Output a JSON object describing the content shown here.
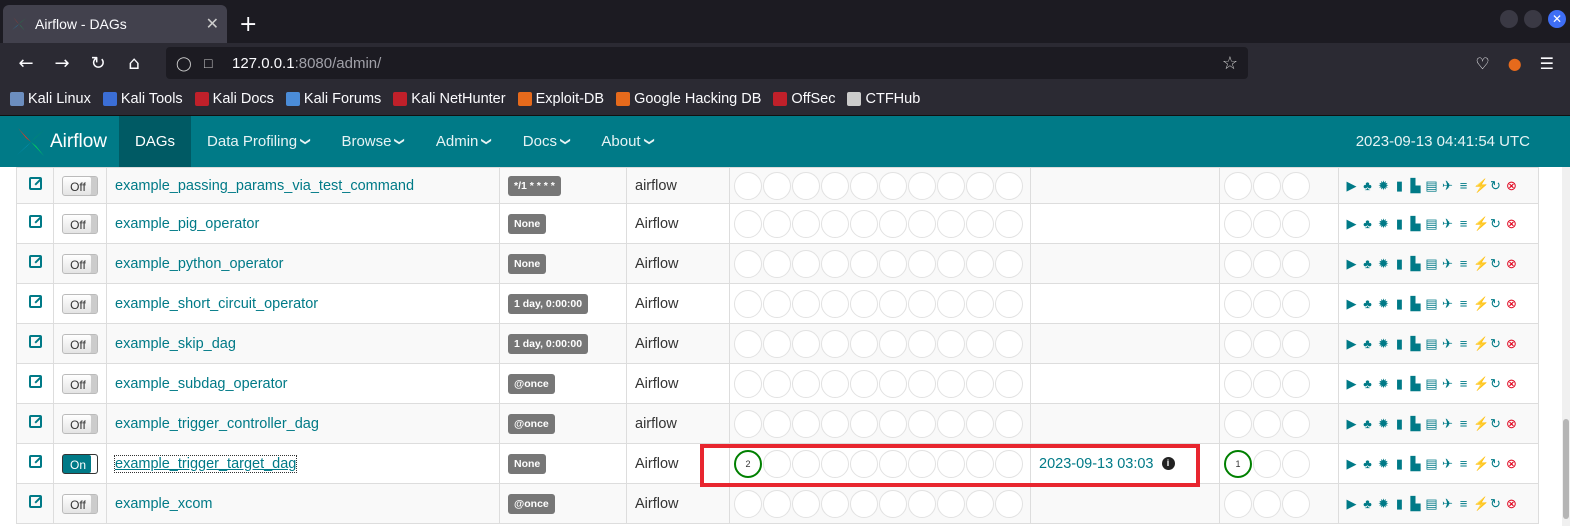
{
  "browser": {
    "tab_title": "Airflow - DAGs",
    "close_symbol": "✕",
    "newtab_symbol": "+",
    "url_host": "127.0.0.1",
    "url_rest": ":8080/admin/",
    "bookmarks": [
      {
        "label": "Kali Linux",
        "color": "#6c8ebf"
      },
      {
        "label": "Kali Tools",
        "color": "#3b6ed6"
      },
      {
        "label": "Kali Docs",
        "color": "#c0202a"
      },
      {
        "label": "Kali Forums",
        "color": "#4b8cd8"
      },
      {
        "label": "Kali NetHunter",
        "color": "#c0202a"
      },
      {
        "label": "Exploit-DB",
        "color": "#e66a1c"
      },
      {
        "label": "Google Hacking DB",
        "color": "#e66a1c"
      },
      {
        "label": "OffSec",
        "color": "#c0202a"
      },
      {
        "label": "CTFHub",
        "color": "#cccccc"
      }
    ]
  },
  "airflow": {
    "brand": "Airflow",
    "menu": [
      {
        "label": "DAGs",
        "active": true,
        "dropdown": false
      },
      {
        "label": "Data Profiling",
        "dropdown": true
      },
      {
        "label": "Browse",
        "dropdown": true
      },
      {
        "label": "Admin",
        "dropdown": true
      },
      {
        "label": "Docs",
        "dropdown": true
      },
      {
        "label": "About",
        "dropdown": true
      }
    ],
    "clock": "2023-09-13 04:41:54 UTC"
  },
  "dags": [
    {
      "name": "example_passing_params_via_test_command",
      "toggle": "Off",
      "schedule": "*/1 * * * *",
      "owner": "airflow",
      "run_success": "",
      "last_run": "",
      "recent_success": ""
    },
    {
      "name": "example_pig_operator",
      "toggle": "Off",
      "schedule": "None",
      "owner": "Airflow",
      "run_success": "",
      "last_run": "",
      "recent_success": ""
    },
    {
      "name": "example_python_operator",
      "toggle": "Off",
      "schedule": "None",
      "owner": "Airflow",
      "run_success": "",
      "last_run": "",
      "recent_success": ""
    },
    {
      "name": "example_short_circuit_operator",
      "toggle": "Off",
      "schedule": "1 day, 0:00:00",
      "owner": "Airflow",
      "run_success": "",
      "last_run": "",
      "recent_success": ""
    },
    {
      "name": "example_skip_dag",
      "toggle": "Off",
      "schedule": "1 day, 0:00:00",
      "owner": "Airflow",
      "run_success": "",
      "last_run": "",
      "recent_success": ""
    },
    {
      "name": "example_subdag_operator",
      "toggle": "Off",
      "schedule": "@once",
      "owner": "Airflow",
      "run_success": "",
      "last_run": "",
      "recent_success": ""
    },
    {
      "name": "example_trigger_controller_dag",
      "toggle": "Off",
      "schedule": "@once",
      "owner": "airflow",
      "run_success": "",
      "last_run": "",
      "recent_success": ""
    },
    {
      "name": "example_trigger_target_dag",
      "toggle": "On",
      "schedule": "None",
      "owner": "Airflow",
      "run_success": "2",
      "last_run": "2023-09-13 03:03",
      "recent_success": "1"
    },
    {
      "name": "example_xcom",
      "toggle": "Off",
      "schedule": "@once",
      "owner": "Airflow",
      "run_success": "",
      "last_run": "",
      "recent_success": ""
    }
  ],
  "info_symbol": "i",
  "link_icons": [
    "play-icon",
    "tree-icon",
    "graph-icon",
    "duration-chart-icon",
    "tries-icon",
    "landing-times-icon",
    "gantt-icon",
    "code-icon",
    "logs-icon",
    "refresh-icon",
    "delete-icon"
  ],
  "colors": {
    "accent": "#007a87",
    "success": "#008000",
    "delete": "#e0001b",
    "highlight": "#e8262f"
  }
}
